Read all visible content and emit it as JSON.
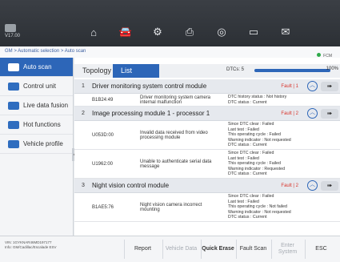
{
  "header": {
    "vci_label": "VCI",
    "vci_version": "V17.00",
    "icons": [
      "home-icon",
      "car-icon",
      "gear-icon",
      "printer-icon",
      "help-icon",
      "save-icon",
      "message-icon"
    ]
  },
  "breadcrumb": "GM > Automatic selection > Auto scan",
  "sidebar": {
    "items": [
      {
        "label": "Auto scan",
        "active": true
      },
      {
        "label": "Control unit",
        "active": false
      },
      {
        "label": "Live data fusion",
        "active": false
      },
      {
        "label": "Hot functions",
        "active": false
      },
      {
        "label": "Vehicle profile",
        "active": false
      }
    ]
  },
  "tabs": {
    "topology": "Topology",
    "list": "List"
  },
  "dtcs": {
    "label": "DTCs: 5",
    "progress_pct": "100%",
    "progress_fraction": 1.0,
    "fcm": "FCM"
  },
  "modules": [
    {
      "num": "1",
      "name": "Driver monitoring system control module",
      "fault": "Fault | 1",
      "dtcs": [
        {
          "code": "B1B24:49",
          "desc": "Driver monitoring system camera internal malfunction",
          "status": [
            "DTC history status : Not history",
            "DTC status : Current"
          ]
        }
      ]
    },
    {
      "num": "2",
      "name": "Image processing module 1 - processor 1",
      "fault": "Fault | 2",
      "dtcs": [
        {
          "code": "U053D:00",
          "desc": "Invalid data received from video processing module",
          "status": [
            "Since DTC clear : Failed",
            "Last test : Failed",
            "This operating cycle : Failed",
            "Warning indicator : Not requested",
            "DTC status : Current"
          ]
        },
        {
          "code": "U1962:00",
          "desc": "Unable to authenticate serial data message",
          "status": [
            "Since DTC clear : Failed",
            "Last test : Failed",
            "This operating cycle : Failed",
            "Warning indicator : Requested",
            "DTC status : Current"
          ]
        }
      ]
    },
    {
      "num": "3",
      "name": "Night vision control module",
      "fault": "Fault | 2",
      "dtcs": [
        {
          "code": "B1AE5:76",
          "desc": "Night vision camera incorrect mounting",
          "status": [
            "Since DTC clear : Failed",
            "Last test : Failed",
            "This operating cycle : Not failed",
            "Warning indicator : Not requested",
            "DTC status : Current"
          ]
        }
      ]
    }
  ],
  "footer": {
    "vin_line1": "VIN: 1GYKNAR46MD197177",
    "vin_line2": "Info: GM/Cadillac/Escalade ESV",
    "buttons": [
      {
        "label": "Report",
        "enabled": true
      },
      {
        "label": "Vehicle Data",
        "enabled": false
      },
      {
        "label": "Quick Erase",
        "enabled": true
      },
      {
        "label": "Fault Scan",
        "enabled": true
      },
      {
        "label": "Enter System",
        "enabled": false
      },
      {
        "label": "ESC",
        "enabled": true
      }
    ]
  }
}
